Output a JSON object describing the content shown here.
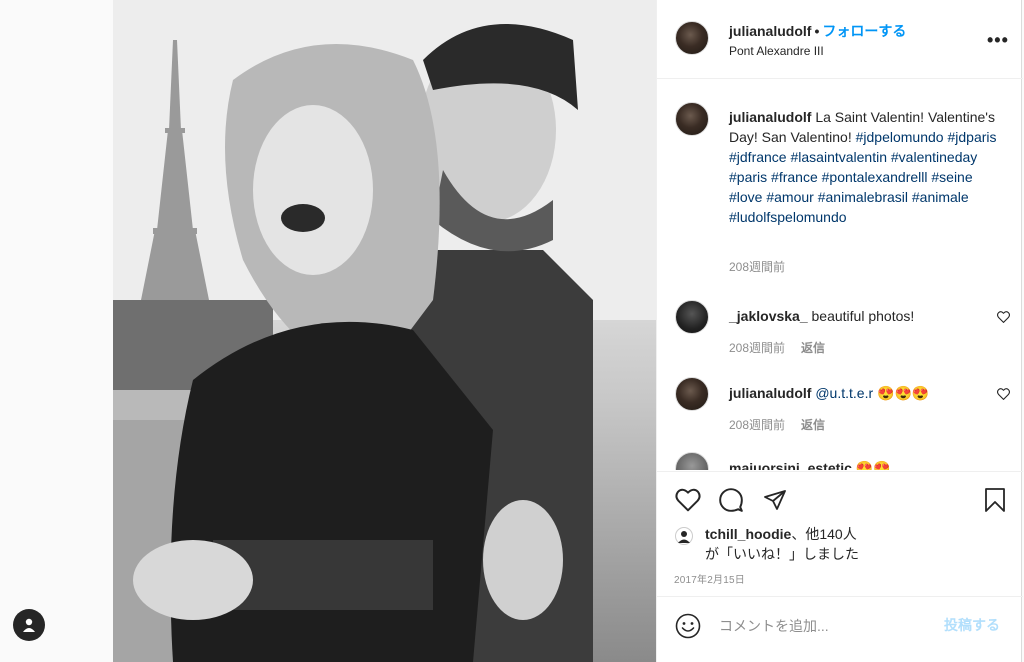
{
  "post": {
    "username": "julianaludolf",
    "separator": "•",
    "follow_label": "フォローする",
    "location": "Pont Alexandre III",
    "more_label": "•••"
  },
  "caption": {
    "username": "julianaludolf",
    "text": "La Saint Valentin! Valentine's Day! San Valentino!",
    "hashtags": [
      "#jdpelomundo",
      "#jdparis",
      "#jdfrance",
      "#lasaintvalentin",
      "#valentineday",
      "#paris",
      "#france",
      "#pontalexandrelll",
      "#seine",
      "#love",
      "#amour",
      "#animalebrasil",
      "#animale",
      "#ludolfspelomundo"
    ],
    "time": "208週間前"
  },
  "comments": [
    {
      "username": "_jaklovska_",
      "text": "beautiful photos!",
      "time": "208週間前",
      "reply": "返信"
    },
    {
      "username": "julianaludolf",
      "text": "@u.t.t.e.r 😍😍😍",
      "time": "208週間前",
      "reply": "返信"
    },
    {
      "username": "maiuorsini_estetic",
      "text": "😍😍",
      "time": "",
      "reply": ""
    }
  ],
  "likes": {
    "username": "tchill_hoodie",
    "suffix": "、他140人",
    "line2": "が「いいね！」しました"
  },
  "date": "2017年2月15日",
  "comment_box": {
    "placeholder": "コメントを追加...",
    "post_label": "投稿する"
  },
  "icons": {
    "like": "heart-icon",
    "comment": "comment-icon",
    "share": "paper-plane-icon",
    "save": "bookmark-icon",
    "emoji": "smiley-icon",
    "user": "user-icon"
  },
  "colors": {
    "link": "#0095f6",
    "hashtag": "#00376b",
    "muted": "#8e8e8e",
    "post_disabled": "#b2dffc"
  }
}
